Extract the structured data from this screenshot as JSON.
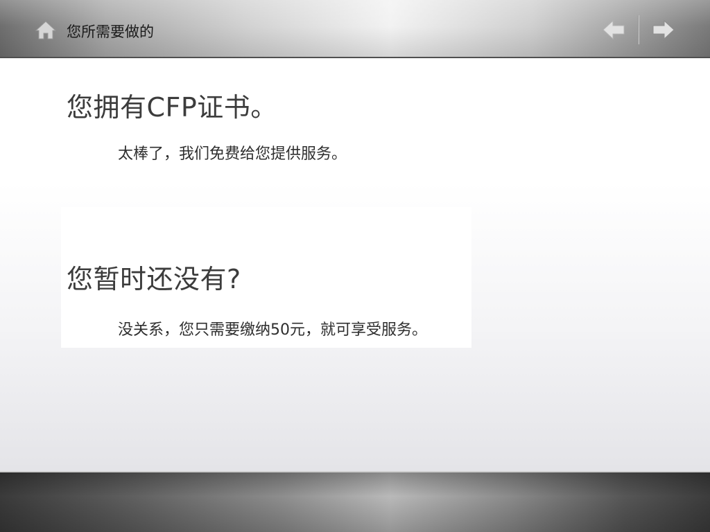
{
  "topbar": {
    "title": "您所需要做的",
    "home_icon": "home-icon",
    "back_icon": "arrow-left-icon",
    "forward_icon": "arrow-right-icon"
  },
  "main": {
    "section1": {
      "heading": "您拥有CFP证书。",
      "text": "太棒了，我们免费给您提供服务。"
    },
    "section2": {
      "heading": "您暂时还没有?",
      "text": "没关系，您只需要缴纳50元，就可享受服务。"
    }
  },
  "colors": {
    "heading_text": "#3c3c3c",
    "body_text": "#2e2e2e",
    "icon_fill": "#d9d9d9"
  }
}
